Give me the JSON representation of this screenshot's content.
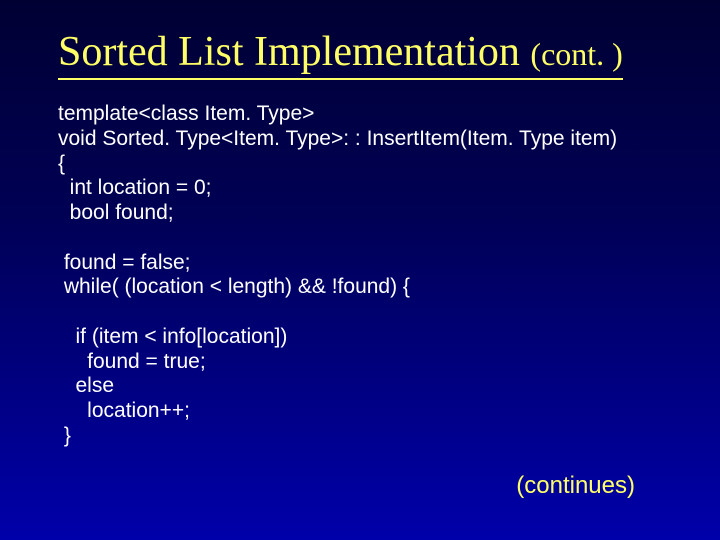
{
  "title_main": "Sorted List Implementation ",
  "title_cont": "(cont. )",
  "code_block": "template<class Item. Type>\nvoid Sorted. Type<Item. Type>: : InsertItem(Item. Type item)\n{\n  int location = 0;\n  bool found;\n\n found = false;\n while( (location < length) && !found) {\n\n   if (item < info[location])\n     found = true;\n   else\n     location++;\n }",
  "continues": "(continues)"
}
